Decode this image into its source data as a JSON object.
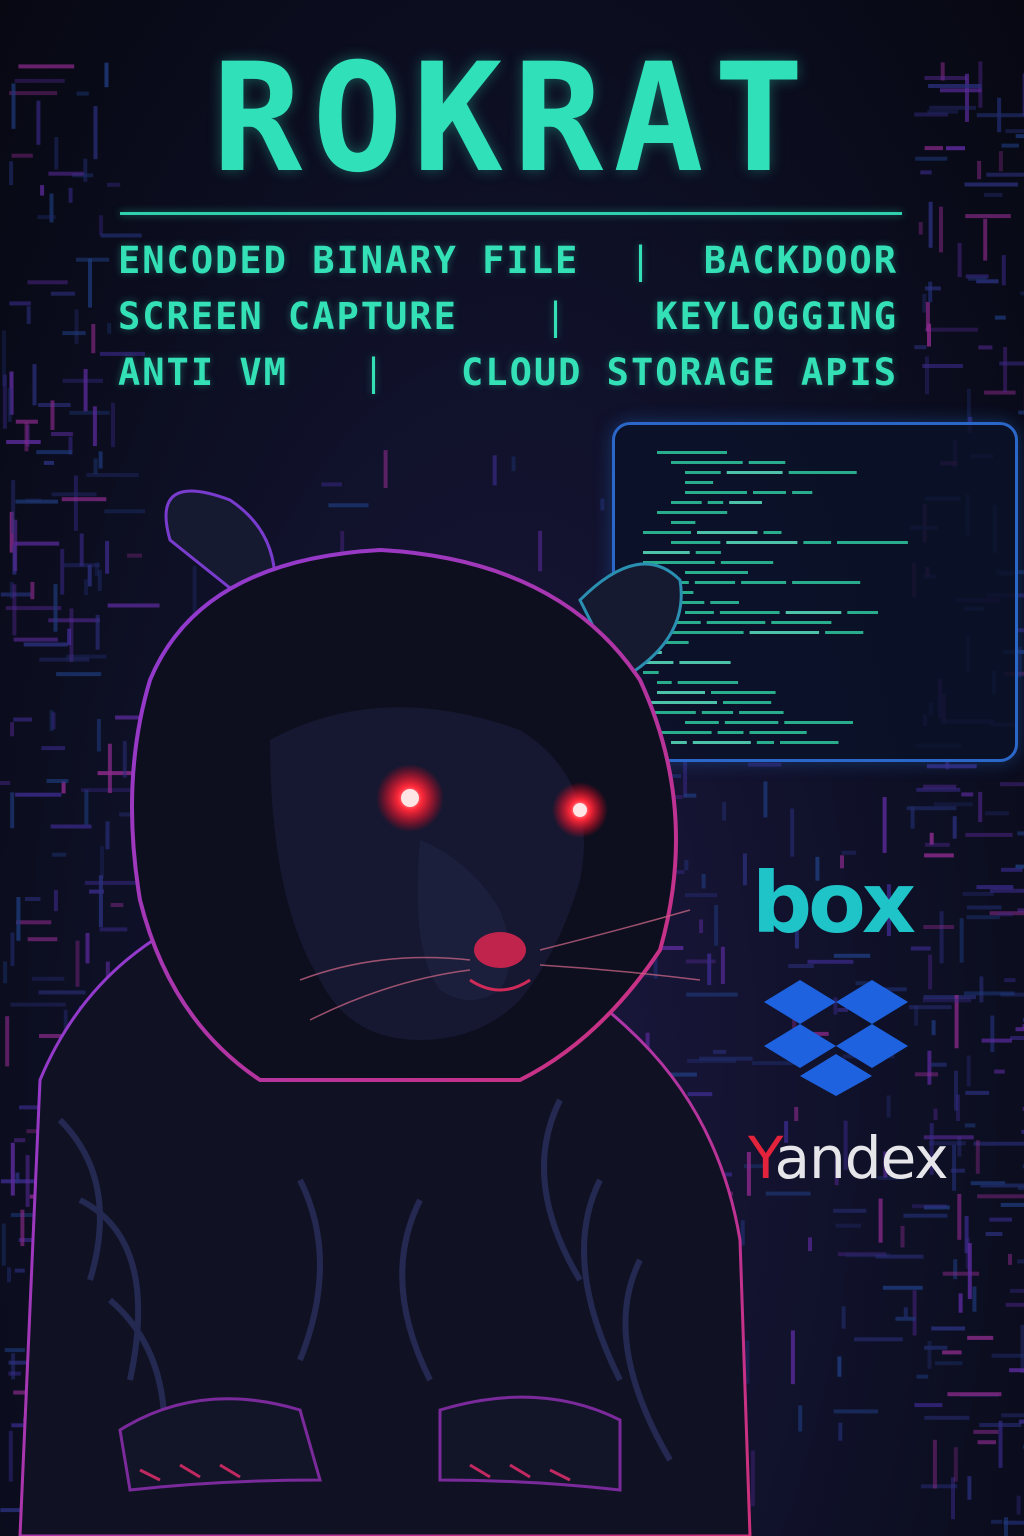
{
  "poster": {
    "title": "ROKRAT",
    "tag_lines": [
      {
        "left": "ENCODED BINARY FILE",
        "separator": "|",
        "right": "BACKDOOR"
      },
      {
        "left": "SCREEN CAPTURE",
        "separator": "|",
        "right": "KEYLOGGING"
      },
      {
        "left": "ANTI VM",
        "separator": "|",
        "right": "CLOUD STORAGE APIS"
      }
    ],
    "logos": {
      "box": "box",
      "dropbox_icon": "dropbox-icon",
      "yandex_first": "Y",
      "yandex_rest": "andex"
    }
  },
  "colors": {
    "accent": "#2fe0b8",
    "terminal_border": "#2b67c8",
    "eyes": "#ff2a3a",
    "box_logo": "#1fc4c9",
    "dropbox_logo": "#1e62e0",
    "yandex_y": "#e3233b",
    "background": "#0a0c1c"
  }
}
